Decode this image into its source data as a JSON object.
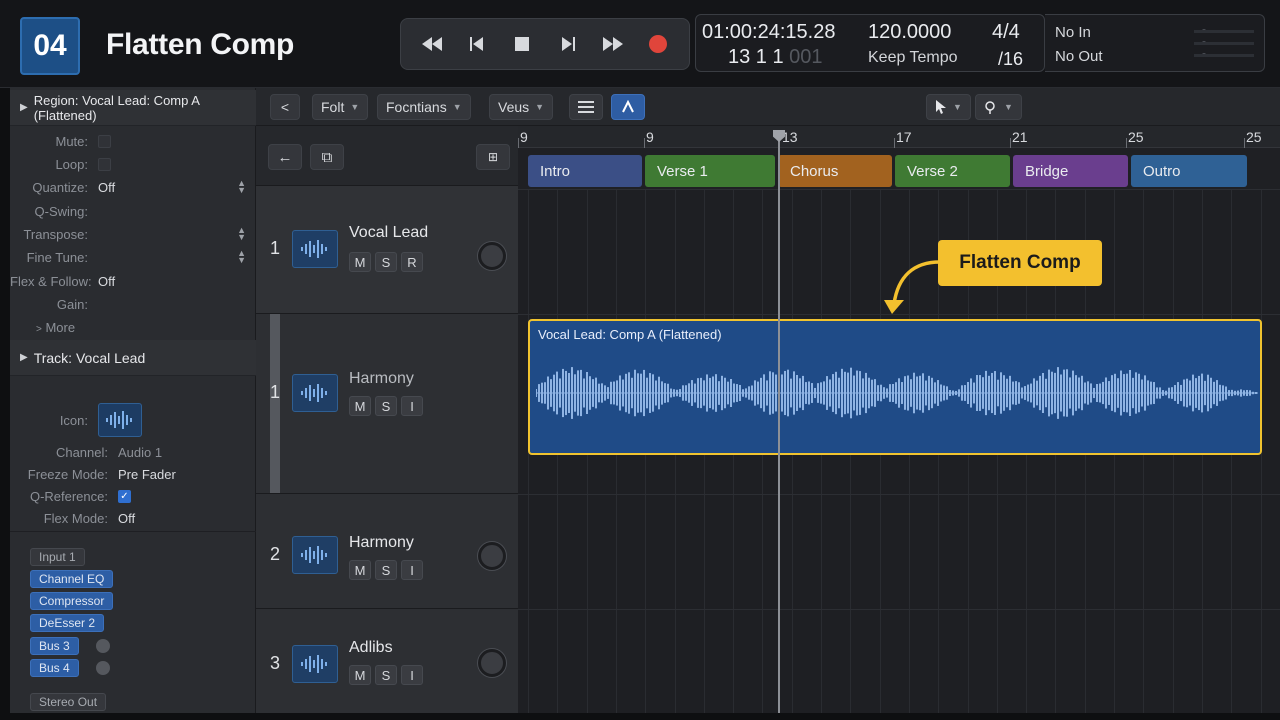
{
  "header": {
    "step": "04",
    "title": "Flatten Comp"
  },
  "transport": {
    "rewind": "rewind-icon",
    "back": "step-back-icon",
    "stop": "stop-icon",
    "play": "play-icon",
    "forward": "fast-forward-icon",
    "record": "record-icon"
  },
  "lcd": {
    "timecode": "01:00:24:15.28",
    "bars_main": "13  1  1 ",
    "bars_sub": "001",
    "tempo": "120.0000",
    "tempo_mode": "Keep Tempo",
    "signature": "4/4",
    "division": "/16"
  },
  "io": {
    "in": "No In",
    "out": "No Out"
  },
  "inspector": {
    "region_header": "Region: Vocal Lead: Comp A (Flattened)",
    "region_params": [
      {
        "label": "Mute:",
        "value": ""
      },
      {
        "label": "Loop:",
        "value": ""
      },
      {
        "label": "Quantize:",
        "value": "Off"
      },
      {
        "label": "Q-Swing:",
        "value": ""
      },
      {
        "label": "Transpose:",
        "value": ""
      },
      {
        "label": "Fine Tune:",
        "value": ""
      },
      {
        "label": "Flex & Follow:",
        "value": "Off"
      },
      {
        "label": "Gain:",
        "value": ""
      }
    ],
    "more": "More",
    "track_header": "Track:  Vocal Lead",
    "track_params": [
      {
        "label": "Icon:",
        "value": ""
      },
      {
        "label": "Channel:",
        "value": "Audio 1"
      },
      {
        "label": "Freeze Mode:",
        "value": "Pre Fader"
      },
      {
        "label": "Q-Reference:",
        "value": ""
      },
      {
        "label": "Flex Mode:",
        "value": "Off"
      }
    ],
    "channel_chips": [
      "Input 1",
      "Channel EQ",
      "Compressor",
      "DeEsser 2",
      "Bus 3",
      "Bus 4",
      "Stereo Out"
    ]
  },
  "toolbar": {
    "back": "chevron-left-icon",
    "menu1": "Folt",
    "menu2": "Focntians",
    "menu3": "Veus"
  },
  "tracks": [
    {
      "number": "1",
      "name": "Vocal Lead",
      "buttons": [
        "M",
        "S",
        "R"
      ]
    },
    {
      "number": "1",
      "name": "Harmony",
      "buttons": [
        "M",
        "S",
        "I"
      ]
    },
    {
      "number": "2",
      "name": "Harmony",
      "buttons": [
        "M",
        "S",
        "I"
      ]
    },
    {
      "number": "3",
      "name": "Adlibs",
      "buttons": [
        "M",
        "S",
        "I"
      ]
    }
  ],
  "ruler": [
    "9",
    "9",
    "13",
    "17",
    "21",
    "25",
    "25"
  ],
  "markers": [
    {
      "label": "Intro",
      "color": "#3b4f86"
    },
    {
      "label": "Verse 1",
      "color": "#3f7a33"
    },
    {
      "label": "Chorus",
      "color": "#a2621f"
    },
    {
      "label": "Verse 2",
      "color": "#3f7a33"
    },
    {
      "label": "Bridge",
      "color": "#6a3e8e"
    },
    {
      "label": "Outro",
      "color": "#2f6195"
    }
  ],
  "region": {
    "name": "Vocal Lead: Comp A (Flattened)",
    "color": "#1f4b87",
    "border": "#f0c32f"
  },
  "callout": "Flatten Comp"
}
